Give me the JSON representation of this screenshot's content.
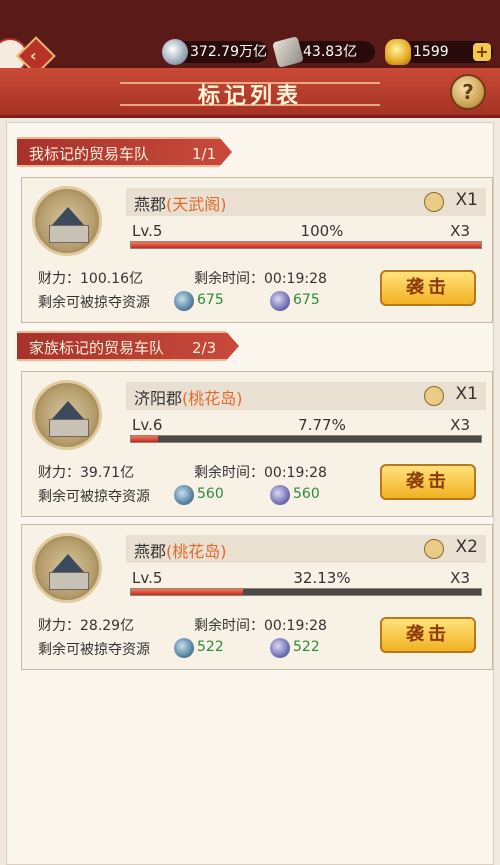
{
  "topbar": {
    "silver": "372.79万亿",
    "tickets": "43.83亿",
    "gold": "1599"
  },
  "header": {
    "title": "标记列表"
  },
  "sections": [
    {
      "label": "我标记的贸易车队",
      "count": "1/1"
    },
    {
      "label": "家族标记的贸易车队",
      "count": "2/3"
    }
  ],
  "labels": {
    "power": "财力：",
    "time": "剩余时间：",
    "loot": "剩余可被掠夺资源",
    "raid": "袭击"
  },
  "convoys": [
    {
      "town": "燕郡",
      "place": "(天武阁)",
      "xcount": "X1",
      "level": "Lv.5",
      "percent": "100%",
      "percent_value": 100,
      "x3": "X3",
      "power": "100.16亿",
      "time": "00:19:28",
      "res_a": "675",
      "res_b": "675"
    },
    {
      "town": "济阳郡",
      "place": "(桃花岛)",
      "xcount": "X1",
      "level": "Lv.6",
      "percent": "7.77%",
      "percent_value": 7.77,
      "x3": "X3",
      "power": "39.71亿",
      "time": "00:19:28",
      "res_a": "560",
      "res_b": "560"
    },
    {
      "town": "燕郡",
      "place": "(桃花岛)",
      "xcount": "X2",
      "level": "Lv.5",
      "percent": "32.13%",
      "percent_value": 32.13,
      "x3": "X3",
      "power": "28.29亿",
      "time": "00:19:28",
      "res_a": "522",
      "res_b": "522"
    }
  ]
}
